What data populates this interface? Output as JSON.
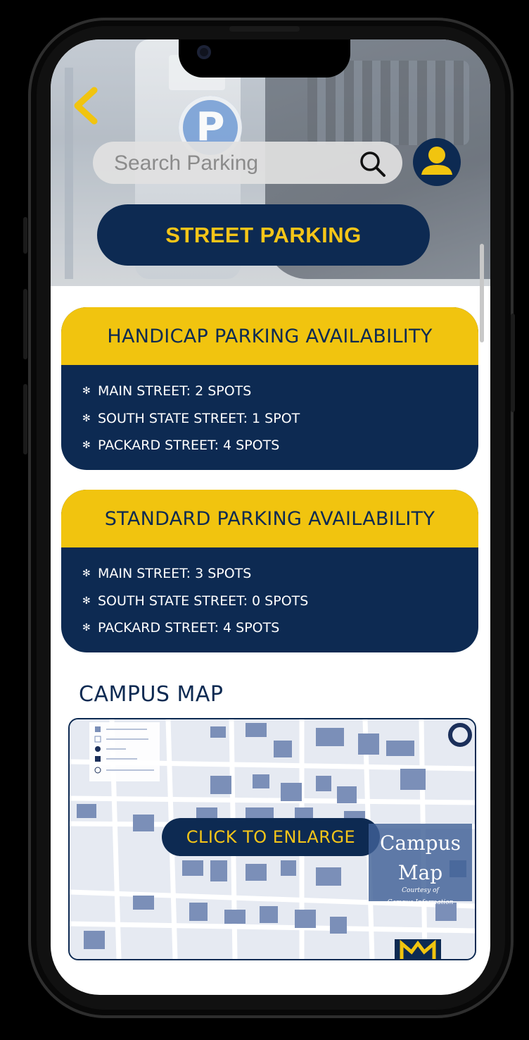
{
  "header": {
    "search_placeholder": "Search Parking",
    "title": "STREET PARKING"
  },
  "handicap": {
    "heading": "HANDICAP PARKING AVAILABILITY",
    "items": [
      "MAIN STREET: 2 SPOTS",
      "SOUTH STATE STREET: 1 SPOT",
      "PACKARD STREET: 4 SPOTS"
    ]
  },
  "standard": {
    "heading": "STANDARD PARKING AVAILABILITY",
    "items": [
      "MAIN STREET: 3 SPOTS",
      "SOUTH STATE STREET: 0 SPOTS",
      "PACKARD STREET: 4 SPOTS"
    ]
  },
  "map": {
    "section_title": "CAMPUS MAP",
    "enlarge_label": "CLICK TO ENLARGE",
    "badge_title_1": "Campus",
    "badge_title_2": "Map",
    "badge_caption_1": "Courtesy of",
    "badge_caption_2": "Campus Information"
  },
  "bullet_glyph": "✻",
  "colors": {
    "navy": "#0d2a52",
    "maize": "#f1c40f",
    "title_text": "#f5c518",
    "white": "#ffffff"
  },
  "icons": [
    "back-chevron-icon",
    "search-icon",
    "user-avatar-icon",
    "bullet-icon"
  ]
}
